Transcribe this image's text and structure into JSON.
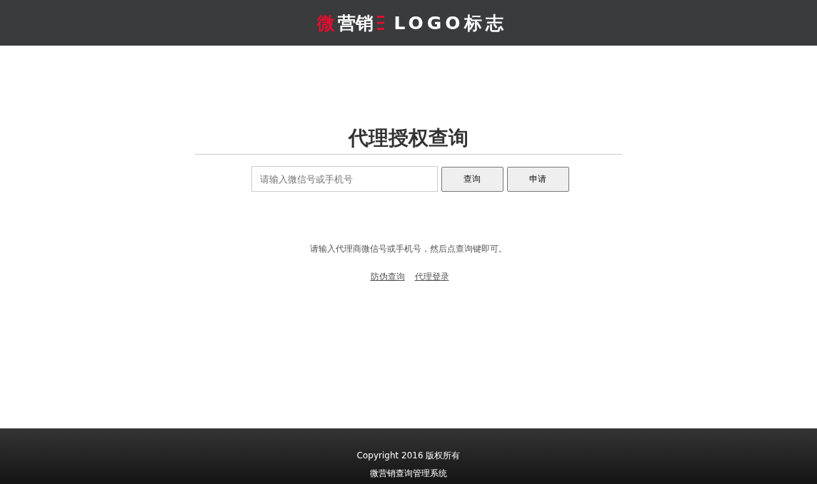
{
  "header": {
    "logo_accent": "微",
    "logo_text": "营销",
    "logo_suffix": "LOGO标志"
  },
  "title": "代理授权查询",
  "search": {
    "placeholder": "请输入微信号或手机号"
  },
  "buttons": [
    "查询",
    "申请"
  ],
  "hint": "请输入代理商微信号或手机号，然后点查询键即可。",
  "links": [
    "防伪查询",
    "代理登录"
  ],
  "footer": {
    "copyright": "Copyright 2016 版权所有",
    "system": "微营销查询管理系统"
  }
}
